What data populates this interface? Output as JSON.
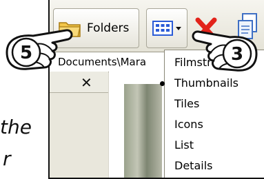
{
  "caption": {
    "line1": "the",
    "line2": "r"
  },
  "toolbar": {
    "folders_label": "Folders"
  },
  "address": {
    "path": "Documents\\Mara"
  },
  "views_menu": {
    "items": [
      {
        "label": "Filmstrip",
        "selected": false
      },
      {
        "label": "Thumbnails",
        "selected": true
      },
      {
        "label": "Tiles",
        "selected": false
      },
      {
        "label": "Icons",
        "selected": false
      },
      {
        "label": "List",
        "selected": false
      },
      {
        "label": "Details",
        "selected": false
      }
    ]
  },
  "callouts": {
    "folders_step": "5",
    "views_step": "3"
  },
  "colors": {
    "delete_red": "#e2231a",
    "folder_yellow": "#f3c64a",
    "views_blue": "#2a5bd7"
  },
  "icons": [
    "folder-icon",
    "views-icon",
    "chevron-down-icon",
    "delete-icon",
    "copy-icon",
    "close-icon"
  ]
}
